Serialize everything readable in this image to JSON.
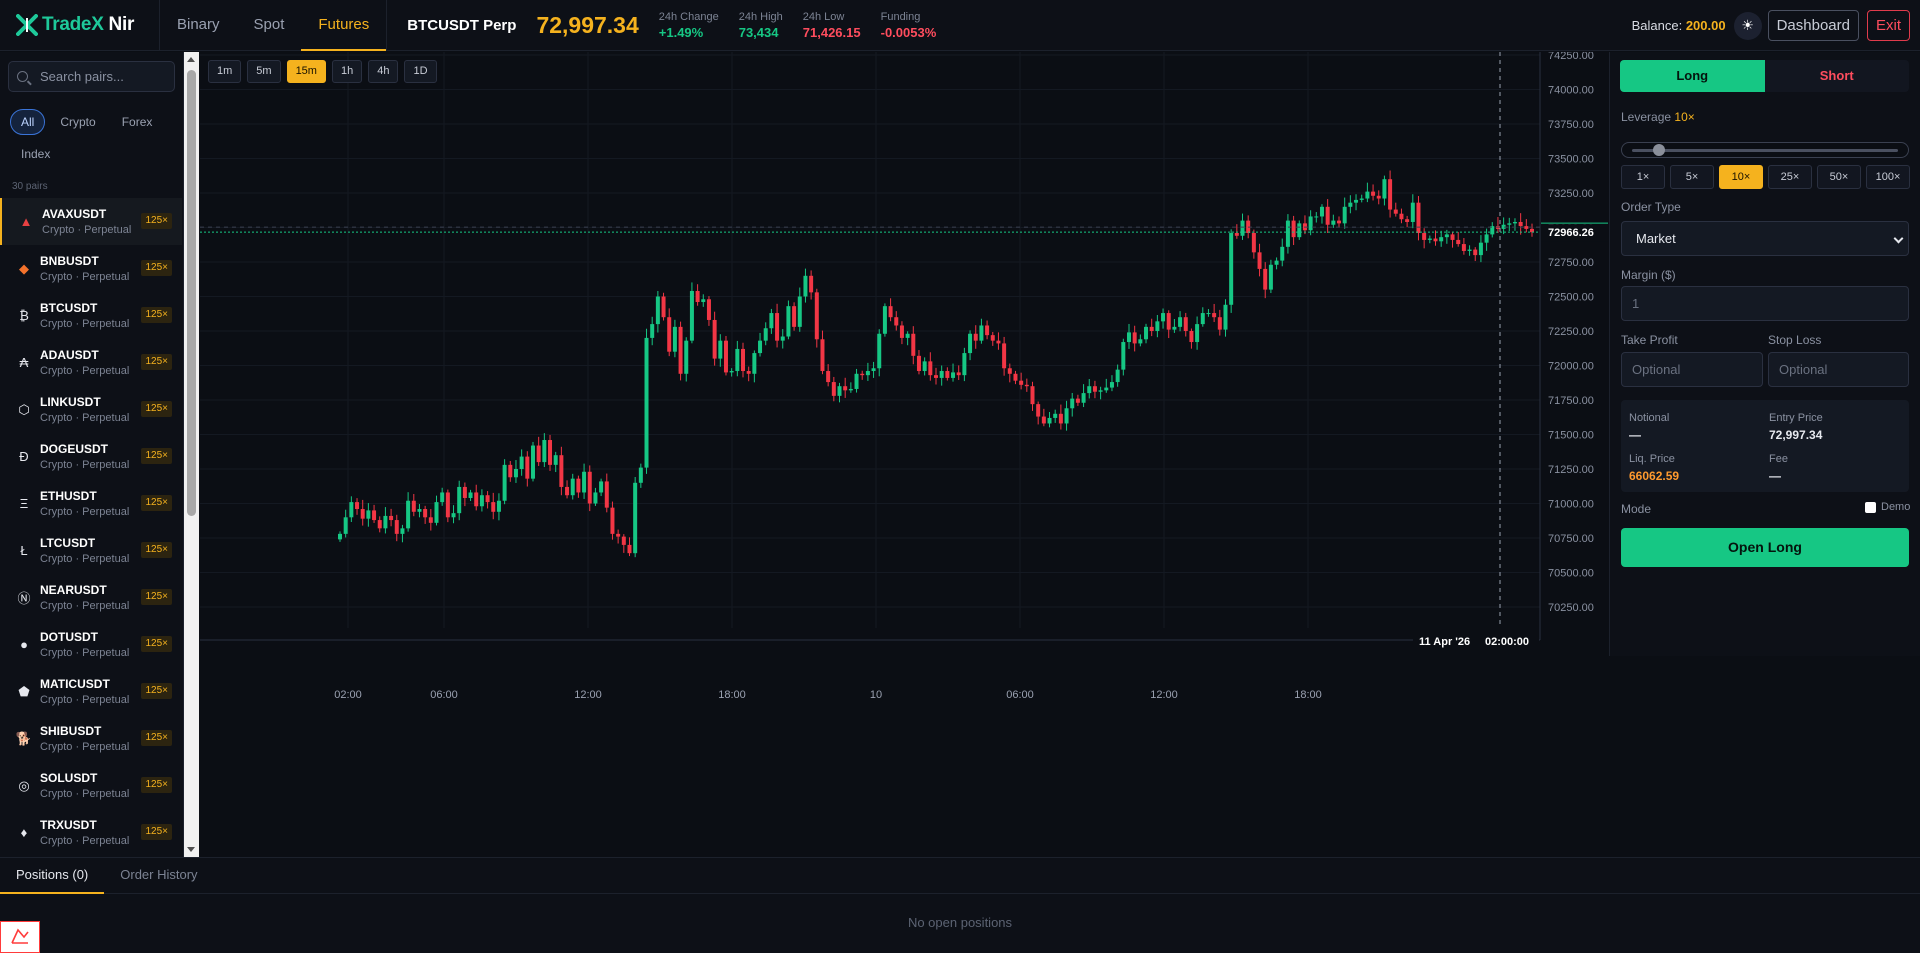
{
  "brand": {
    "name_a": "TradeX",
    "name_b": " Nir"
  },
  "nav": [
    {
      "label": "Binary",
      "active": false
    },
    {
      "label": "Spot",
      "active": false
    },
    {
      "label": "Futures",
      "active": true
    }
  ],
  "ticker": {
    "symbol": "BTCUSDT Perp",
    "price": "72,997.34",
    "stats": [
      {
        "label": "24h Change",
        "value": "+1.49%",
        "tone": "green"
      },
      {
        "label": "24h High",
        "value": "73,434",
        "tone": "green"
      },
      {
        "label": "24h Low",
        "value": "71,426.15",
        "tone": "red"
      },
      {
        "label": "Funding",
        "value": "-0.0053%",
        "tone": "red"
      }
    ]
  },
  "header_right": {
    "balance_label": "Balance:",
    "balance_value": "200.00",
    "theme_icon": "sun-icon",
    "dashboard": "Dashboard",
    "exit": "Exit"
  },
  "sidebar": {
    "search_placeholder": "Search pairs...",
    "filters": [
      {
        "label": "All",
        "active": true
      },
      {
        "label": "Crypto",
        "active": false
      },
      {
        "label": "Forex",
        "active": false
      },
      {
        "label": "Index",
        "active": false
      }
    ],
    "count": "30 pairs",
    "pairs": [
      {
        "symbol": "AVAXUSDT",
        "sub": "Crypto · Perpetual",
        "lev": "125×",
        "icon": "avax-icon",
        "glyph": "▲",
        "color": "#e84142",
        "active": true
      },
      {
        "symbol": "BNBUSDT",
        "sub": "Crypto · Perpetual",
        "lev": "125×",
        "icon": "bnb-icon",
        "glyph": "◆",
        "color": "#f3722c",
        "active": false
      },
      {
        "symbol": "BTCUSDT",
        "sub": "Crypto · Perpetual",
        "lev": "125×",
        "icon": "btc-icon",
        "glyph": "₿",
        "color": "#e6e8ee",
        "active": false
      },
      {
        "symbol": "ADAUSDT",
        "sub": "Crypto · Perpetual",
        "lev": "125×",
        "icon": "ada-icon",
        "glyph": "₳",
        "color": "#e6e8ee",
        "active": false
      },
      {
        "symbol": "LINKUSDT",
        "sub": "Crypto · Perpetual",
        "lev": "125×",
        "icon": "link-icon",
        "glyph": "⬡",
        "color": "#e6e8ee",
        "active": false
      },
      {
        "symbol": "DOGEUSDT",
        "sub": "Crypto · Perpetual",
        "lev": "125×",
        "icon": "doge-icon",
        "glyph": "Ð",
        "color": "#e6e8ee",
        "active": false
      },
      {
        "symbol": "ETHUSDT",
        "sub": "Crypto · Perpetual",
        "lev": "125×",
        "icon": "eth-icon",
        "glyph": "Ξ",
        "color": "#e6e8ee",
        "active": false
      },
      {
        "symbol": "LTCUSDT",
        "sub": "Crypto · Perpetual",
        "lev": "125×",
        "icon": "ltc-icon",
        "glyph": "Ł",
        "color": "#e6e8ee",
        "active": false
      },
      {
        "symbol": "NEARUSDT",
        "sub": "Crypto · Perpetual",
        "lev": "125×",
        "icon": "near-icon",
        "glyph": "Ⓝ",
        "color": "#e6e8ee",
        "active": false
      },
      {
        "symbol": "DOTUSDT",
        "sub": "Crypto · Perpetual",
        "lev": "125×",
        "icon": "dot-icon",
        "glyph": "●",
        "color": "#e6e8ee",
        "active": false
      },
      {
        "symbol": "MATICUSDT",
        "sub": "Crypto · Perpetual",
        "lev": "125×",
        "icon": "matic-icon",
        "glyph": "⬟",
        "color": "#e6e8ee",
        "active": false
      },
      {
        "symbol": "SHIBUSDT",
        "sub": "Crypto · Perpetual",
        "lev": "125×",
        "icon": "shib-icon",
        "glyph": "🐕",
        "color": "#f5a623",
        "active": false
      },
      {
        "symbol": "SOLUSDT",
        "sub": "Crypto · Perpetual",
        "lev": "125×",
        "icon": "sol-icon",
        "glyph": "◎",
        "color": "#e6e8ee",
        "active": false
      },
      {
        "symbol": "TRXUSDT",
        "sub": "Crypto · Perpetual",
        "lev": "125×",
        "icon": "trx-icon",
        "glyph": "♦",
        "color": "#e6e8ee",
        "active": false
      }
    ]
  },
  "timeframes": [
    {
      "label": "1m",
      "active": false
    },
    {
      "label": "5m",
      "active": false
    },
    {
      "label": "15m",
      "active": true
    },
    {
      "label": "1h",
      "active": false
    },
    {
      "label": "4h",
      "active": false
    },
    {
      "label": "1D",
      "active": false
    }
  ],
  "chart_data": {
    "type": "candlestick",
    "y_ticks": [
      "74250.00",
      "74000.00",
      "73750.00",
      "73500.00",
      "73250.00",
      "73000.00",
      "72750.00",
      "72500.00",
      "72250.00",
      "72000.00",
      "71750.00",
      "71500.00",
      "71250.00",
      "71000.00",
      "70750.00",
      "70500.00",
      "70250.00"
    ],
    "ylim": [
      70125,
      74250
    ],
    "x_ticks": [
      "02:00",
      "06:00",
      "12:00",
      "18:00",
      "10",
      "06:00",
      "12:00",
      "18:00"
    ],
    "current_price": "72966.26",
    "current_price_value": 72966.26,
    "crosshair_time": {
      "date": "11 Apr '26",
      "time": "02:00:00"
    },
    "colors": {
      "up": "#16c784",
      "down": "#f23645"
    },
    "closes": [
      70780,
      70900,
      71010,
      70960,
      70890,
      70950,
      70880,
      70820,
      70910,
      70880,
      70780,
      70820,
      71020,
      70940,
      70960,
      70900,
      70860,
      71010,
      71080,
      70900,
      70930,
      71120,
      71040,
      71080,
      70980,
      71060,
      71010,
      70940,
      71020,
      71280,
      71190,
      71250,
      71340,
      71180,
      71420,
      71300,
      71460,
      71280,
      71350,
      71120,
      71060,
      71180,
      71080,
      71230,
      71000,
      71080,
      71160,
      70970,
      70780,
      70760,
      70700,
      70640,
      71150,
      71260,
      72200,
      72300,
      72500,
      72350,
      72100,
      72280,
      71940,
      72180,
      72540,
      72460,
      72480,
      72330,
      72050,
      72180,
      71950,
      71960,
      72120,
      71960,
      71940,
      72090,
      72180,
      72270,
      72380,
      72180,
      72210,
      72430,
      72280,
      72500,
      72650,
      72530,
      72190,
      71960,
      71880,
      71780,
      71850,
      71820,
      71830,
      71940,
      71930,
      71960,
      71980,
      72230,
      72430,
      72350,
      72290,
      72200,
      72230,
      72070,
      71960,
      72030,
      71930,
      71910,
      71960,
      71910,
      71950,
      71930,
      72090,
      72230,
      72180,
      72290,
      72220,
      72180,
      72160,
      71980,
      71940,
      71890,
      71860,
      71850,
      71720,
      71630,
      71580,
      71620,
      71650,
      71580,
      71690,
      71760,
      71730,
      71800,
      71850,
      71810,
      71820,
      71840,
      71880,
      71970,
      72170,
      72240,
      72160,
      72190,
      72280,
      72250,
      72320,
      72380,
      72260,
      72280,
      72350,
      72250,
      72170,
      72300,
      72380,
      72380,
      72350,
      72260,
      72440,
      72960,
      72940,
      73050,
      72960,
      72820,
      72700,
      72550,
      72730,
      72760,
      72860,
      73050,
      72930,
      73030,
      72980,
      73080,
      73080,
      73150,
      73020,
      73050,
      73030,
      73150,
      73180,
      73200,
      73210,
      73260,
      73230,
      73210,
      73350,
      73130,
      73100,
      73060,
      73040,
      73180,
      72960,
      72910,
      72920,
      72900,
      72930,
      72950,
      72910,
      72880,
      72830,
      72840,
      72800,
      72890,
      72950,
      73010,
      72990,
      73020,
      73030,
      73040,
      73010,
      72990,
      72966
    ]
  },
  "order": {
    "long": "Long",
    "short": "Short",
    "leverage_label": "Leverage",
    "leverage_value": "10×",
    "leverage_options": [
      {
        "label": "1×",
        "active": false
      },
      {
        "label": "5×",
        "active": false
      },
      {
        "label": "10×",
        "active": true
      },
      {
        "label": "25×",
        "active": false
      },
      {
        "label": "50×",
        "active": false
      },
      {
        "label": "100×",
        "active": false
      }
    ],
    "order_type_label": "Order Type",
    "order_type_value": "Market",
    "margin_label": "Margin ($)",
    "margin_value": "1",
    "tp_label": "Take Profit",
    "tp_placeholder": "Optional",
    "sl_label": "Stop Loss",
    "sl_placeholder": "Optional",
    "summary": {
      "notional_label": "Notional",
      "notional_value": "—",
      "entry_label": "Entry Price",
      "entry_value": "72,997.34",
      "liq_label": "Liq. Price",
      "liq_value": "66062.59",
      "fee_label": "Fee",
      "fee_value": "—"
    },
    "mode_label": "Mode",
    "demo_label": "Demo",
    "open_button": "Open Long"
  },
  "bottom": {
    "tabs": [
      {
        "label": "Positions (0)",
        "active": true
      },
      {
        "label": "Order History",
        "active": false
      }
    ],
    "empty": "No open positions"
  }
}
